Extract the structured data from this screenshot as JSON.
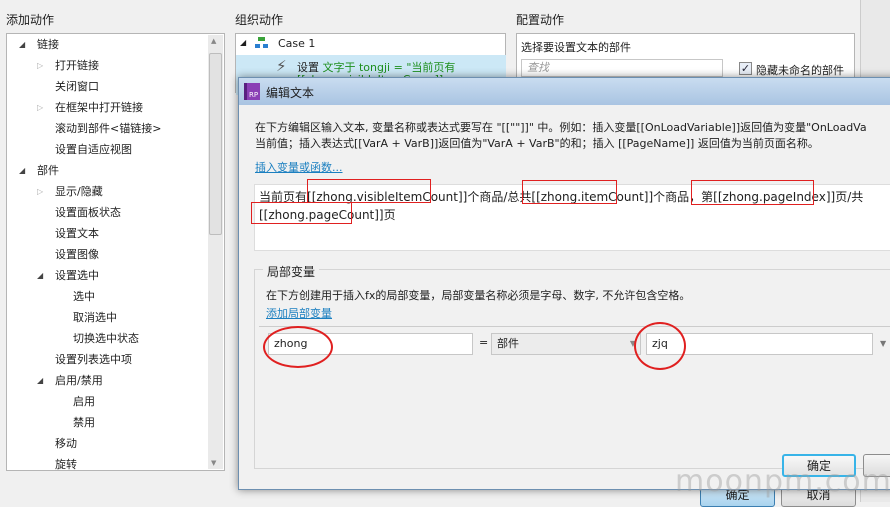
{
  "left_panel": {
    "title": "添加动作",
    "items": [
      {
        "label": "链接",
        "level": 0,
        "toggle": "open"
      },
      {
        "label": "打开链接",
        "level": 1,
        "toggle": "closed"
      },
      {
        "label": "关闭窗口",
        "level": 1,
        "toggle": ""
      },
      {
        "label": "在框架中打开链接",
        "level": 1,
        "toggle": "closed"
      },
      {
        "label": "滚动到部件<锚链接>",
        "level": 1,
        "toggle": ""
      },
      {
        "label": "设置自适应视图",
        "level": 1,
        "toggle": ""
      },
      {
        "label": "部件",
        "level": 0,
        "toggle": "open"
      },
      {
        "label": "显示/隐藏",
        "level": 1,
        "toggle": "closed"
      },
      {
        "label": "设置面板状态",
        "level": 1,
        "toggle": ""
      },
      {
        "label": "设置文本",
        "level": 1,
        "toggle": ""
      },
      {
        "label": "设置图像",
        "level": 1,
        "toggle": ""
      },
      {
        "label": "设置选中",
        "level": 1,
        "toggle": "open"
      },
      {
        "label": "选中",
        "level": 2,
        "toggle": ""
      },
      {
        "label": "取消选中",
        "level": 2,
        "toggle": ""
      },
      {
        "label": "切换选中状态",
        "level": 2,
        "toggle": ""
      },
      {
        "label": "设置列表选中项",
        "level": 1,
        "toggle": ""
      },
      {
        "label": "启用/禁用",
        "level": 1,
        "toggle": "open"
      },
      {
        "label": "启用",
        "level": 2,
        "toggle": ""
      },
      {
        "label": "禁用",
        "level": 2,
        "toggle": ""
      },
      {
        "label": "移动",
        "level": 1,
        "toggle": ""
      },
      {
        "label": "旋转",
        "level": 1,
        "toggle": ""
      }
    ]
  },
  "middle_panel": {
    "title": "组织动作",
    "case": "Case 1",
    "action_prefix": "设置",
    "action_detail": "文字于 tongji = \"当前页有",
    "action_detail2": "[[zhong.visibleItemCou...]]"
  },
  "right_panel": {
    "title": "配置动作",
    "subtitle": "选择要设置文本的部件",
    "search_placeholder": "查找",
    "hide_unnamed_label": "隐藏未命名的部件",
    "hide_unnamed_checked": true
  },
  "dialog": {
    "app_icon": "RP",
    "title": "编辑文本",
    "instruction_line1": "在下方编辑区输入文本, 变量名称或表达式要写在 \"[[\"\"]]\" 中。例如：插入变量[[OnLoadVariable]]返回值为变量\"OnLoadVa",
    "instruction_line2": "当前值；插入表达式[[VarA + VarB]]返回值为\"VarA + VarB\"的和；插入 [[PageName]] 返回值为当前页面名称。",
    "insert_link": "插入变量或函数...",
    "editor_text": {
      "t1": "当前页有",
      "v1": "[[zhong.visibleItemCount]]",
      "t2": "个商品/总共",
      "v2": "[[zhong.itemCount]]",
      "t3": "个商品，第",
      "v3": "[[zhong.pageIndex]]",
      "t4": "页/共",
      "v4": "[[zhong.pageCount]]",
      "t5": "页"
    },
    "local_vars": {
      "group_title": "局部变量",
      "description": "在下方创建用于插入fx的局部变量，局部变量名称必须是字母、数字, 不允许包含空格。",
      "add_link": "添加局部变量",
      "rows": [
        {
          "name": "zhong",
          "equals": "=",
          "type": "部件",
          "target": "zjq"
        }
      ]
    },
    "ok_label": "确定"
  },
  "parent_buttons": {
    "ok": "确定",
    "cancel": "取消"
  },
  "watermark": "moonpm.com",
  "colors": {
    "annotation": "#e02020",
    "link": "#1a7fc0",
    "selection": "#cce8f6"
  }
}
